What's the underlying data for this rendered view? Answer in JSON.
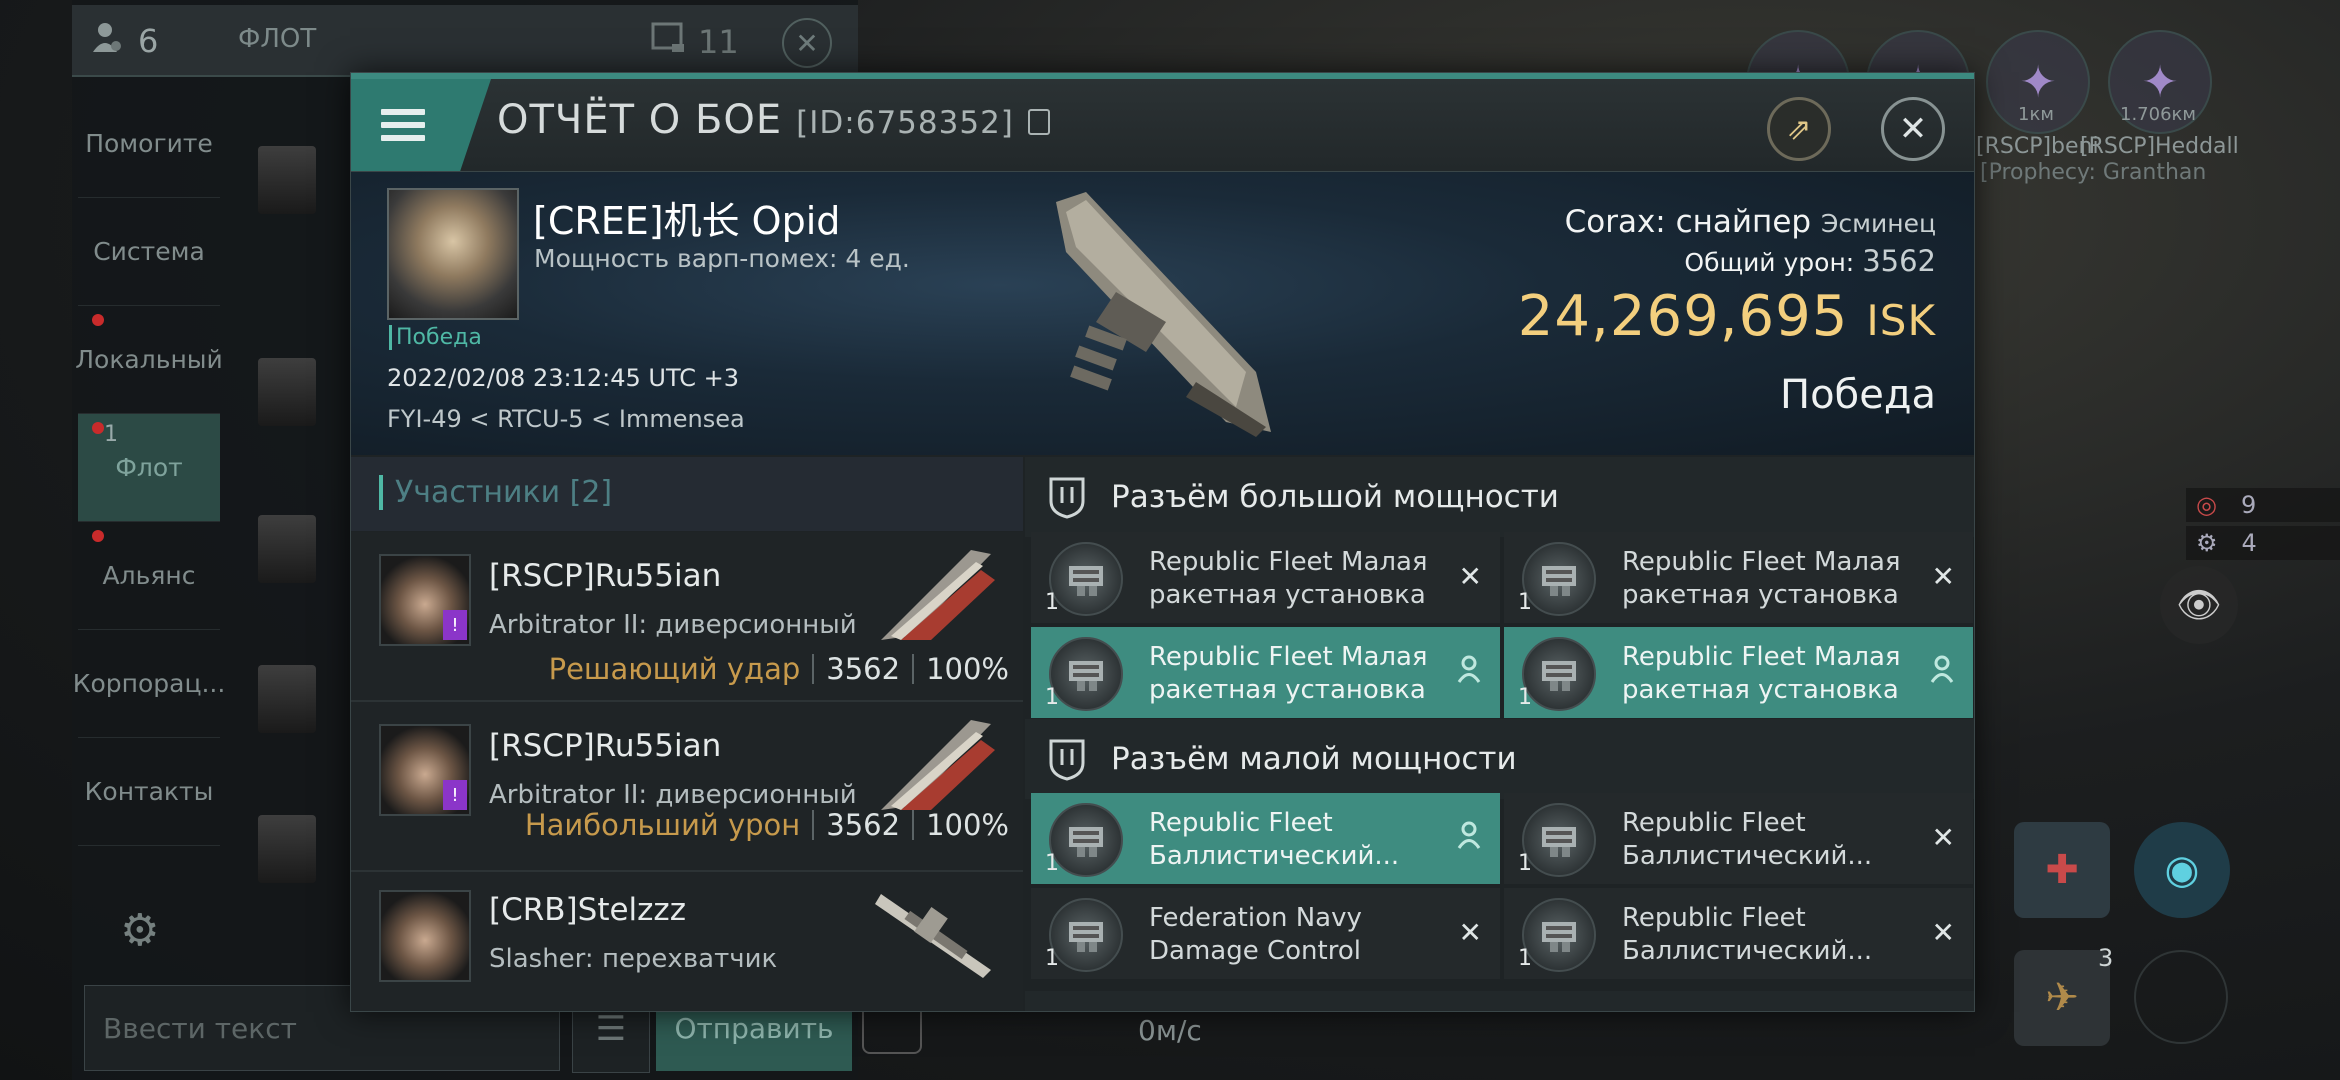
{
  "background": {
    "fleet_count": "6",
    "fleet_title": "ФЛОТ",
    "message_count": "11",
    "sidebar": [
      {
        "label": "Помогите",
        "dot": false,
        "num": ""
      },
      {
        "label": "Система",
        "dot": false,
        "num": ""
      },
      {
        "label": "Локальный",
        "dot": true,
        "num": ""
      },
      {
        "label": "Флот",
        "dot": true,
        "num": "1",
        "active": true
      },
      {
        "label": "Альянс",
        "dot": true,
        "num": ""
      },
      {
        "label": "Корпорац...",
        "dot": false,
        "num": ""
      },
      {
        "label": "Контакты",
        "dot": false,
        "num": ""
      }
    ],
    "input_placeholder": "Ввести текст",
    "send_label": "Отправить",
    "speed": "0м/с"
  },
  "hud": {
    "targets": [
      {
        "dist": "",
        "name": ""
      },
      {
        "dist": "",
        "name": ""
      },
      {
        "dist": "1км",
        "name": "[RSCP]beni"
      },
      {
        "dist": "1.706км",
        "name": "[RSCP]Heddall"
      }
    ],
    "target_ships": "[Prophecy: Granthan",
    "stat_a": "9",
    "stat_b": "4",
    "module_count": "3"
  },
  "report": {
    "title": "ОТЧЁТ О БОЕ",
    "id": "[ID:6758352]",
    "victim": {
      "name": "[CREE]机长 Opid",
      "subtitle": "Мощность варп-помех: 4 ед.",
      "tag": "Победа",
      "datetime": "2022/02/08 23:12:45 UTC +3",
      "location": "FYI-49 < RTCU-5 < Immensea",
      "ship": "Corax: снайпер",
      "ship_class": "Эсминец",
      "damage_label": "Общий урон:",
      "damage_value": "3562",
      "isk_value": "24,269,695",
      "isk_unit": "ISK",
      "result": "Победа"
    },
    "participants_label": "Участники",
    "participants_count": "[2]",
    "participants": [
      {
        "name": "[RSCP]Ru55ian",
        "ship": "Arbitrator II: диверсионный",
        "role": "Решающий удар",
        "damage": "3562",
        "percent": "100%"
      },
      {
        "name": "[RSCP]Ru55ian",
        "ship": "Arbitrator II: диверсионный",
        "role": "Наибольший урон",
        "damage": "3562",
        "percent": "100%"
      },
      {
        "name": "[CRB]Stelzzz",
        "ship": "Slasher: перехватчик",
        "role": "",
        "damage": "",
        "percent": ""
      }
    ],
    "high_slot_title": "Разъём большой мощности",
    "low_slot_title": "Разъём малой мощности",
    "high_modules": [
      {
        "name": "Republic Fleet Малая ракетная установка",
        "qty": "1",
        "state": "✕",
        "highlight": false
      },
      {
        "name": "Republic Fleet Малая ракетная установка",
        "qty": "1",
        "state": "✕",
        "highlight": false
      },
      {
        "name": "Republic Fleet Малая ракетная установка",
        "qty": "1",
        "state": "person",
        "highlight": true
      },
      {
        "name": "Republic Fleet Малая ракетная установка",
        "qty": "1",
        "state": "person",
        "highlight": true
      }
    ],
    "low_modules": [
      {
        "name": "Republic Fleet Баллистический...",
        "qty": "1",
        "state": "person",
        "highlight": true
      },
      {
        "name": "Republic Fleet Баллистический...",
        "qty": "1",
        "state": "✕",
        "highlight": false
      },
      {
        "name": "Federation Navy Damage Control",
        "qty": "1",
        "state": "✕",
        "highlight": false
      },
      {
        "name": "Republic Fleet Баллистический...",
        "qty": "1",
        "state": "✕",
        "highlight": false
      }
    ]
  }
}
